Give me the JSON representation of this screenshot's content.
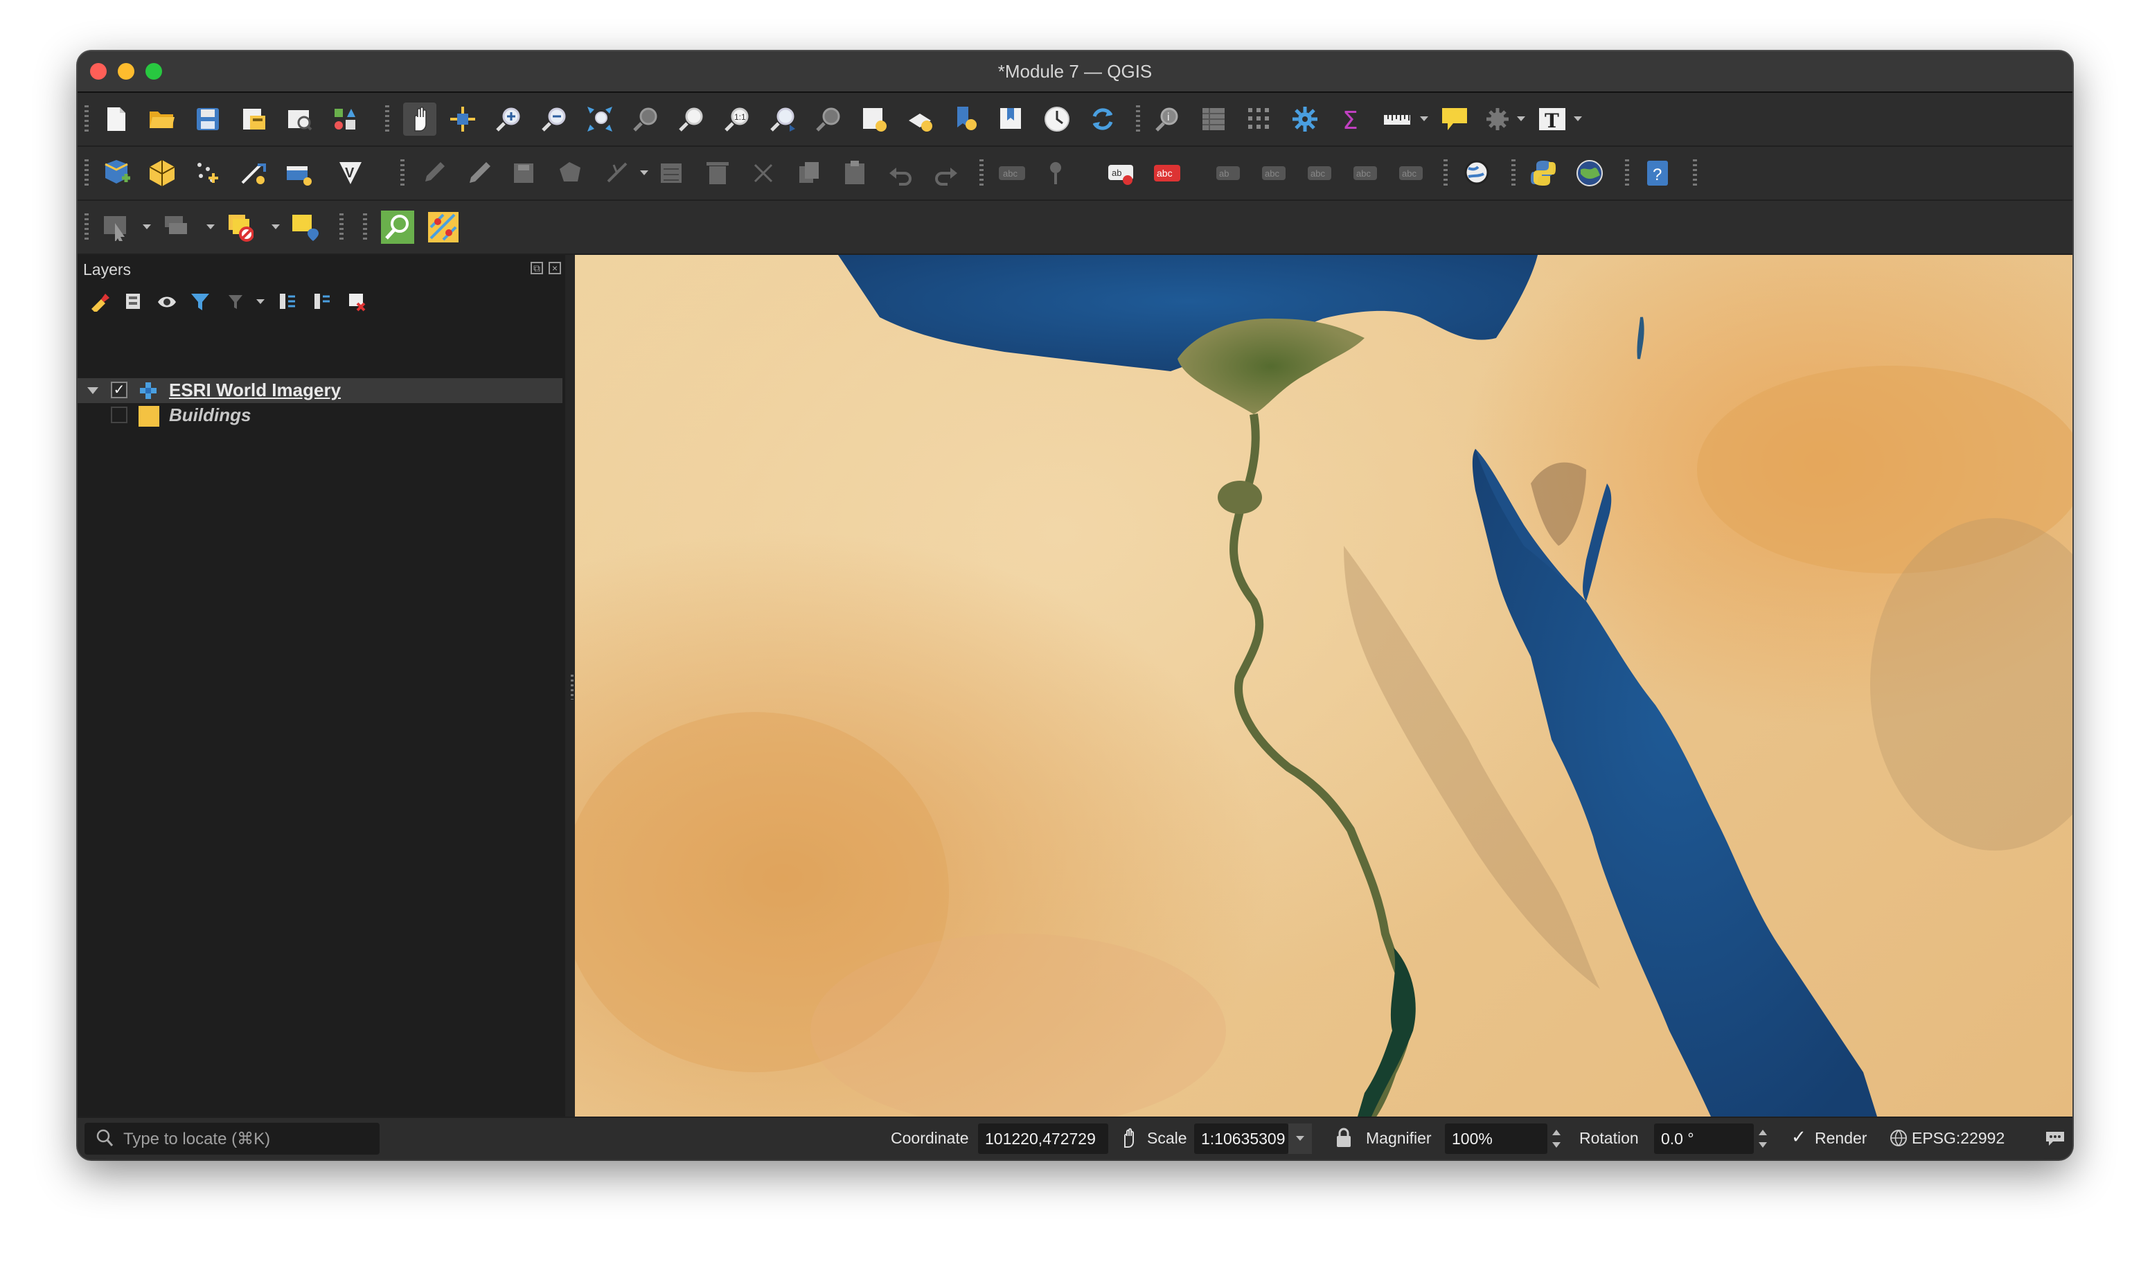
{
  "window": {
    "title": "*Module 7 — QGIS"
  },
  "toolbars": {
    "row1": [
      {
        "icon": "new-project-icon"
      },
      {
        "icon": "open-project-icon"
      },
      {
        "icon": "save-project-icon"
      },
      {
        "icon": "new-print-layout-icon"
      },
      {
        "icon": "layout-manager-icon"
      },
      {
        "icon": "style-manager-icon"
      },
      {
        "icon": "pan-map-icon"
      },
      {
        "icon": "pan-to-selection-icon"
      },
      {
        "icon": "zoom-in-icon"
      },
      {
        "icon": "zoom-out-icon"
      },
      {
        "icon": "zoom-full-icon"
      },
      {
        "icon": "zoom-to-selection-icon"
      },
      {
        "icon": "zoom-to-layer-icon"
      },
      {
        "icon": "zoom-native-icon"
      },
      {
        "icon": "zoom-last-icon"
      },
      {
        "icon": "zoom-next-icon"
      },
      {
        "icon": "new-map-view-icon"
      },
      {
        "icon": "new-3d-map-view-icon"
      },
      {
        "icon": "new-bookmark-icon"
      },
      {
        "icon": "show-bookmarks-icon"
      },
      {
        "icon": "temporal-controller-icon"
      },
      {
        "icon": "refresh-icon"
      },
      {
        "icon": "identify-features-icon"
      },
      {
        "icon": "open-attribute-table-icon"
      },
      {
        "icon": "field-calculator-icon"
      },
      {
        "icon": "processing-toolbox-icon"
      },
      {
        "icon": "statistical-summary-icon"
      },
      {
        "icon": "measure-line-icon"
      },
      {
        "icon": "map-tips-icon"
      },
      {
        "icon": "actions-icon"
      },
      {
        "icon": "text-annotation-icon"
      }
    ],
    "row2": [
      {
        "icon": "data-source-manager-icon"
      },
      {
        "icon": "new-geopackage-layer-icon"
      },
      {
        "icon": "new-temporary-layer-icon"
      },
      {
        "icon": "digitize-with-segment-icon"
      },
      {
        "icon": "new-virtual-layer-icon"
      },
      {
        "icon": "vertex-editor-icon"
      },
      {
        "icon": "current-edits-icon"
      },
      {
        "icon": "toggle-editing-icon"
      },
      {
        "icon": "save-edits-icon"
      },
      {
        "icon": "add-feature-icon"
      },
      {
        "icon": "vertex-tool-icon"
      },
      {
        "icon": "modify-attributes-icon"
      },
      {
        "icon": "delete-selected-icon"
      },
      {
        "icon": "cut-features-icon"
      },
      {
        "icon": "copy-features-icon"
      },
      {
        "icon": "paste-features-icon"
      },
      {
        "icon": "undo-icon"
      },
      {
        "icon": "redo-icon"
      },
      {
        "icon": "label-toolbar-icon"
      },
      {
        "icon": "pin-labels-icon"
      },
      {
        "icon": "highlight-pinned-labels-icon"
      },
      {
        "icon": "show-hide-labels-icon"
      },
      {
        "icon": "move-label-icon"
      },
      {
        "icon": "rotate-label-icon"
      },
      {
        "icon": "change-label-icon"
      },
      {
        "icon": "label-properties-icon"
      },
      {
        "icon": "label-diagram-icon"
      },
      {
        "icon": "globe-plugin-icon"
      },
      {
        "icon": "python-console-icon"
      },
      {
        "icon": "qgis-cloud-icon"
      },
      {
        "icon": "help-icon"
      }
    ],
    "row3": [
      {
        "icon": "select-features-icon"
      },
      {
        "icon": "select-by-value-icon"
      },
      {
        "icon": "deselect-features-icon"
      },
      {
        "icon": "select-by-location-icon"
      },
      {
        "icon": "locator-search-icon"
      },
      {
        "icon": "plugin-tool-icon"
      }
    ]
  },
  "layers_panel": {
    "title": "Layers",
    "tools": [
      {
        "icon": "open-layer-styling-icon"
      },
      {
        "icon": "add-group-icon"
      },
      {
        "icon": "manage-map-themes-icon"
      },
      {
        "icon": "filter-legend-icon"
      },
      {
        "icon": "filter-by-expression-icon"
      },
      {
        "icon": "expand-all-icon"
      },
      {
        "icon": "collapse-all-icon"
      },
      {
        "icon": "remove-layer-icon"
      }
    ],
    "layers": [
      {
        "name": "ESRI World Imagery",
        "checked": true,
        "selected": true,
        "type": "raster"
      },
      {
        "name": "Buildings",
        "checked": false,
        "selected": false,
        "type": "vector",
        "color": "#f4c242"
      }
    ]
  },
  "statusbar": {
    "locator_placeholder": "Type to locate (⌘K)",
    "coordinate_label": "Coordinate",
    "coordinate_value": "101220,472729",
    "scale_label": "Scale",
    "scale_value": "1:10635309",
    "magnifier_label": "Magnifier",
    "magnifier_value": "100%",
    "rotation_label": "Rotation",
    "rotation_value": "0.0 °",
    "render_label": "Render",
    "render_checked": true,
    "crs_label": "EPSG:22992"
  },
  "colors": {
    "sea": "#1c4f86",
    "desert": "#ecc98f",
    "nile": "#5c6b36"
  }
}
